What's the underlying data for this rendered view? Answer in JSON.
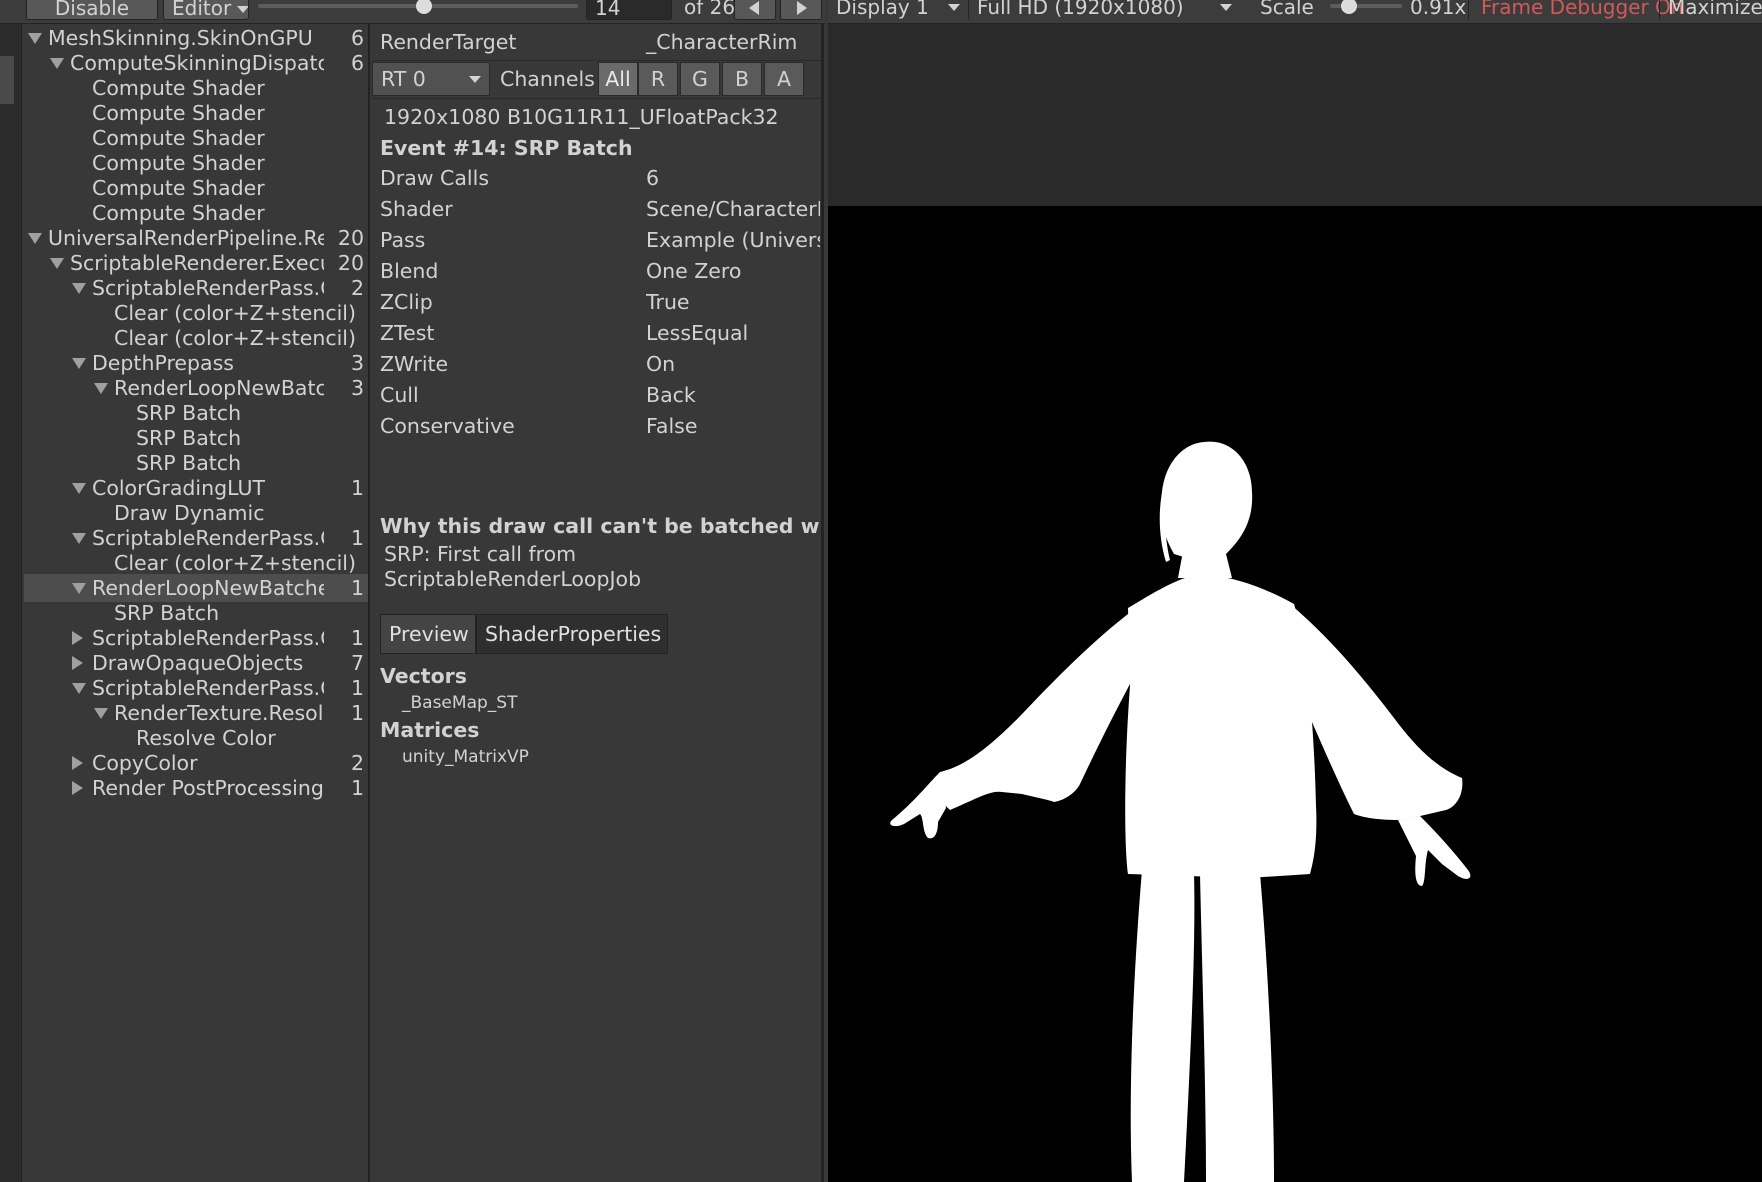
{
  "toolbar": {
    "disable_label": "Disable",
    "editor_label": "Editor",
    "event_index": "14",
    "event_total_label": "of 26",
    "prev_icon": "triangle-left",
    "next_icon": "triangle-right",
    "event_progress": 0.52
  },
  "game_toolbar": {
    "display_label": "Display 1",
    "resolution_label": "Full HD (1920x1080)",
    "scale_label": "Scale",
    "scale_value": "0.91x",
    "scale_position": 0.15,
    "frame_debugger_label": "Frame Debugger On",
    "frame_debugger_color": "#d05a5a",
    "maximize_label": "Maximize"
  },
  "hierarchy": {
    "rows": [
      {
        "label": "MeshSkinning.SkinOnGPU",
        "count": "6",
        "depth": 0,
        "arrow": "open",
        "selected": false
      },
      {
        "label": "ComputeSkinningDispatch",
        "count": "6",
        "depth": 1,
        "arrow": "open",
        "selected": false
      },
      {
        "label": "Compute Shader",
        "count": "",
        "depth": 2,
        "arrow": "none",
        "selected": false
      },
      {
        "label": "Compute Shader",
        "count": "",
        "depth": 2,
        "arrow": "none",
        "selected": false
      },
      {
        "label": "Compute Shader",
        "count": "",
        "depth": 2,
        "arrow": "none",
        "selected": false
      },
      {
        "label": "Compute Shader",
        "count": "",
        "depth": 2,
        "arrow": "none",
        "selected": false
      },
      {
        "label": "Compute Shader",
        "count": "",
        "depth": 2,
        "arrow": "none",
        "selected": false
      },
      {
        "label": "Compute Shader",
        "count": "",
        "depth": 2,
        "arrow": "none",
        "selected": false
      },
      {
        "label": "UniversalRenderPipeline.Ren",
        "count": "20",
        "depth": 0,
        "arrow": "open",
        "selected": false
      },
      {
        "label": "ScriptableRenderer.Executi",
        "count": "20",
        "depth": 1,
        "arrow": "open",
        "selected": false
      },
      {
        "label": "ScriptableRenderPass.Co",
        "count": "2",
        "depth": 2,
        "arrow": "open",
        "selected": false
      },
      {
        "label": "Clear (color+Z+stencil)",
        "count": "",
        "depth": 3,
        "arrow": "none",
        "selected": false
      },
      {
        "label": "Clear (color+Z+stencil)",
        "count": "",
        "depth": 3,
        "arrow": "none",
        "selected": false
      },
      {
        "label": "DepthPrepass",
        "count": "3",
        "depth": 2,
        "arrow": "open",
        "selected": false
      },
      {
        "label": "RenderLoopNewBatche",
        "count": "3",
        "depth": 3,
        "arrow": "open",
        "selected": false
      },
      {
        "label": "SRP Batch",
        "count": "",
        "depth": 4,
        "arrow": "none",
        "selected": false
      },
      {
        "label": "SRP Batch",
        "count": "",
        "depth": 4,
        "arrow": "none",
        "selected": false
      },
      {
        "label": "SRP Batch",
        "count": "",
        "depth": 4,
        "arrow": "none",
        "selected": false
      },
      {
        "label": "ColorGradingLUT",
        "count": "1",
        "depth": 2,
        "arrow": "open",
        "selected": false
      },
      {
        "label": "Draw Dynamic",
        "count": "",
        "depth": 3,
        "arrow": "none",
        "selected": false
      },
      {
        "label": "ScriptableRenderPass.Co",
        "count": "1",
        "depth": 2,
        "arrow": "open",
        "selected": false
      },
      {
        "label": "Clear (color+Z+stencil)",
        "count": "",
        "depth": 3,
        "arrow": "none",
        "selected": false
      },
      {
        "label": "RenderLoopNewBatcher.[",
        "count": "1",
        "depth": 2,
        "arrow": "open",
        "selected": true
      },
      {
        "label": "SRP Batch",
        "count": "",
        "depth": 3,
        "arrow": "none",
        "selected": false
      },
      {
        "label": "ScriptableRenderPass.Co",
        "count": "1",
        "depth": 2,
        "arrow": "closed",
        "selected": false
      },
      {
        "label": "DrawOpaqueObjects",
        "count": "7",
        "depth": 2,
        "arrow": "closed",
        "selected": false
      },
      {
        "label": "ScriptableRenderPass.Co",
        "count": "1",
        "depth": 2,
        "arrow": "open",
        "selected": false
      },
      {
        "label": "RenderTexture.Resolve",
        "count": "1",
        "depth": 3,
        "arrow": "open",
        "selected": false
      },
      {
        "label": "Resolve Color",
        "count": "",
        "depth": 4,
        "arrow": "none",
        "selected": false
      },
      {
        "label": "CopyColor",
        "count": "2",
        "depth": 2,
        "arrow": "closed",
        "selected": false
      },
      {
        "label": "Render PostProcessing Ef",
        "count": "1",
        "depth": 2,
        "arrow": "closed",
        "selected": false
      }
    ]
  },
  "details": {
    "render_target_label": "RenderTarget",
    "render_target_value": "_CharacterRim",
    "rt_select_value": "RT 0",
    "channels_label": "Channels",
    "channel_buttons": [
      "All",
      "R",
      "G",
      "B",
      "A"
    ],
    "active_channel": "All",
    "format_text": "1920x1080 B10G11R11_UFloatPack32",
    "event_title": "Event #14: SRP Batch",
    "properties": [
      {
        "name": "Draw Calls",
        "value": "6"
      },
      {
        "name": "Shader",
        "value": "Scene/CharacterR"
      },
      {
        "name": "Pass",
        "value": "Example (Universa"
      },
      {
        "name": "Blend",
        "value": "One Zero"
      },
      {
        "name": "ZClip",
        "value": "True"
      },
      {
        "name": "ZTest",
        "value": "LessEqual"
      },
      {
        "name": "ZWrite",
        "value": "On"
      },
      {
        "name": "Cull",
        "value": "Back"
      },
      {
        "name": "Conservative",
        "value": "False"
      }
    ],
    "batch_heading": "Why this draw call can't be batched with the",
    "batch_reason_line1": "SRP: First call from",
    "batch_reason_line2": "ScriptableRenderLoopJob",
    "tabs": [
      "Preview",
      "ShaderProperties"
    ],
    "active_tab": "Preview",
    "vectors_heading": "Vectors",
    "vectors_items": [
      "_BaseMap_ST"
    ],
    "matrices_heading": "Matrices",
    "matrices_items": [
      "unity_MatrixVP"
    ]
  },
  "game_view": {
    "background_color": "#000000",
    "silhouette_color": "#ffffff",
    "content": "character-silhouette"
  }
}
